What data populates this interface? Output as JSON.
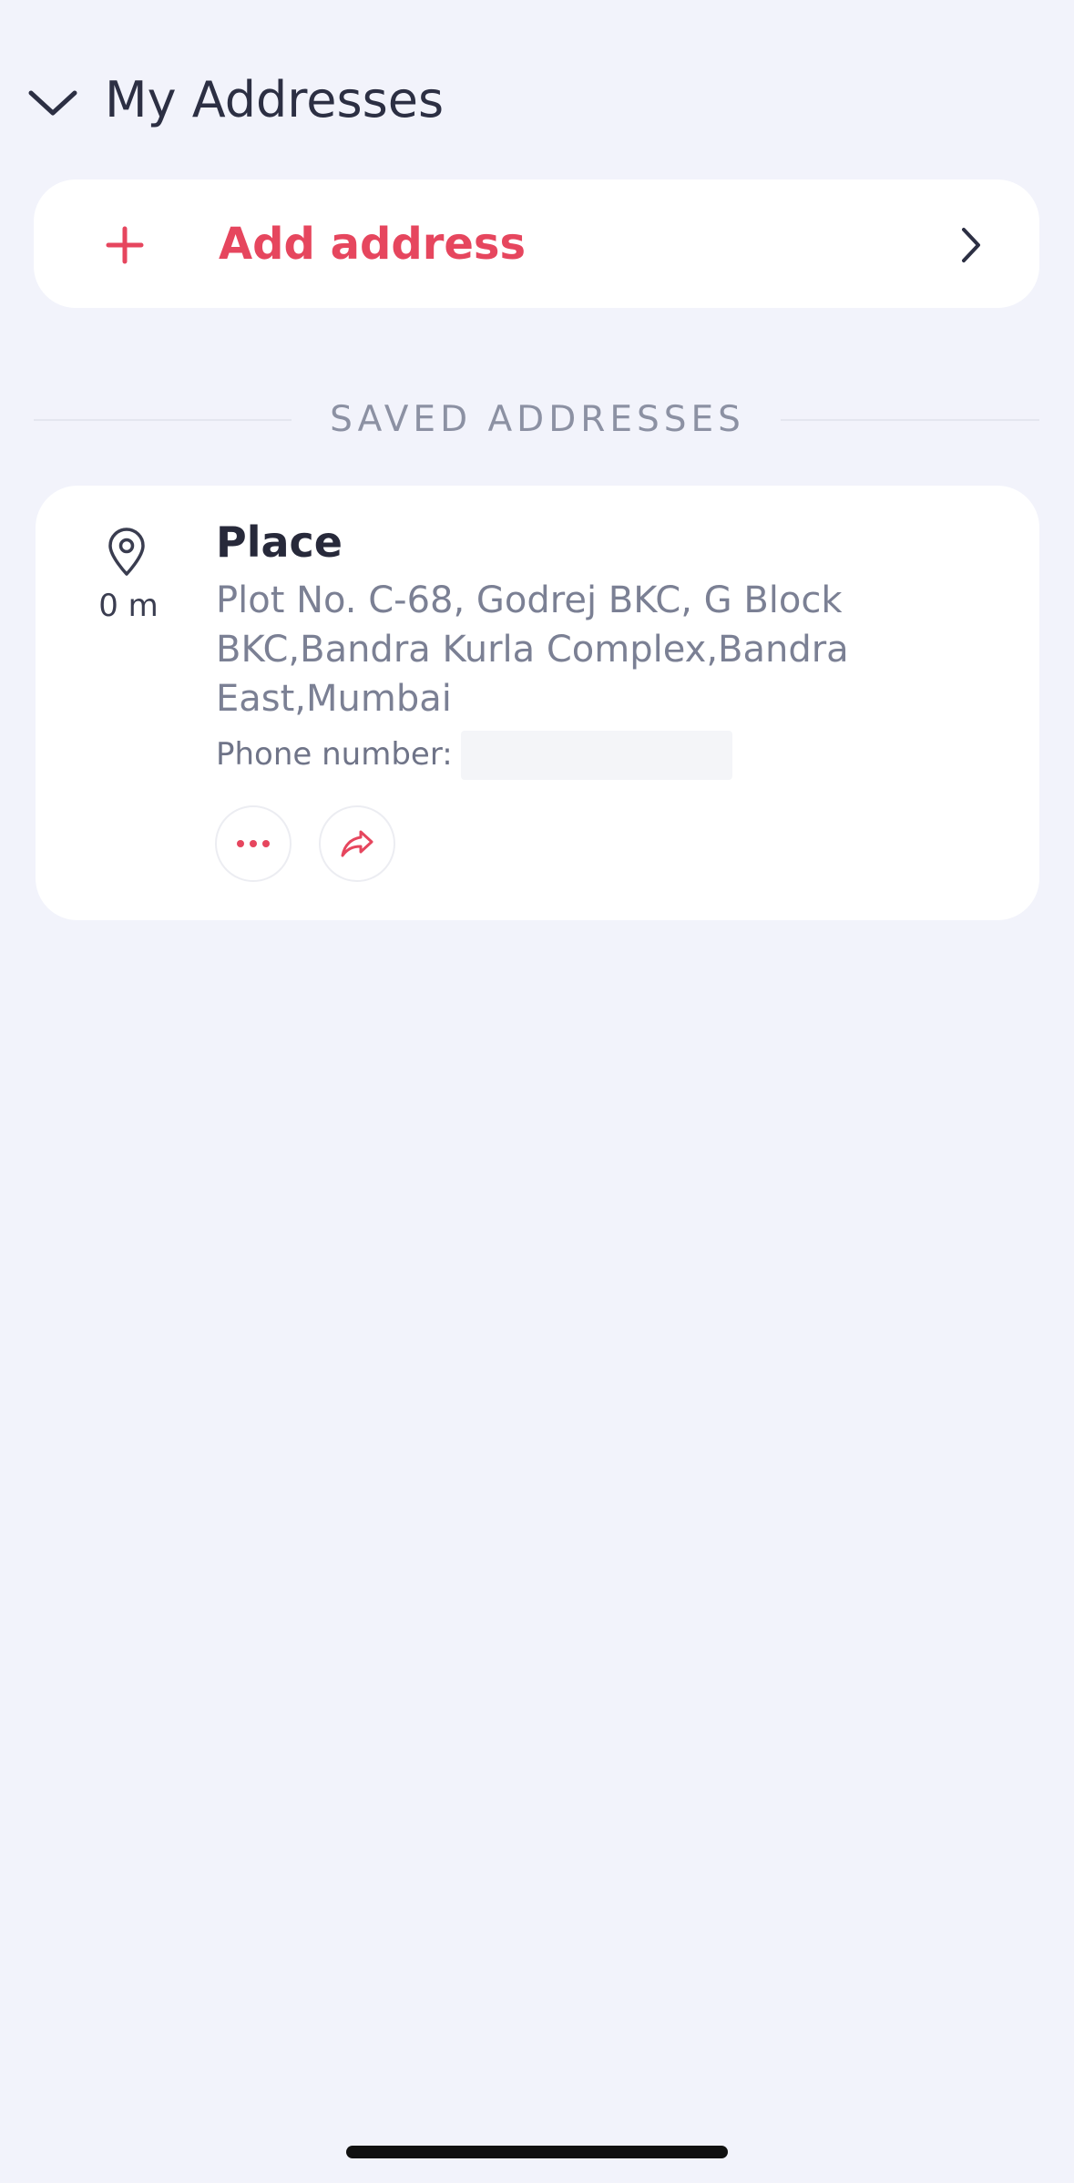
{
  "header": {
    "title": "My Addresses",
    "back_icon": "chevron-down-icon"
  },
  "add_address": {
    "label": "Add address",
    "icon": "plus-icon",
    "trailing_icon": "chevron-right-icon",
    "accent_color": "#E6465E"
  },
  "saved_section": {
    "heading": "SAVED ADDRESSES"
  },
  "addresses": [
    {
      "name": "Place",
      "distance": "0 m",
      "address": "Plot No. C-68, Godrej BKC, G Block BKC,Bandra Kurla Complex,Bandra East,Mumbai",
      "phone_label": "Phone number:",
      "phone_value": "",
      "actions": [
        {
          "name": "more",
          "icon": "more-dots-icon"
        },
        {
          "name": "share",
          "icon": "share-icon"
        }
      ]
    }
  ],
  "colors": {
    "background": "#F2F3FB",
    "card": "#FFFFFF",
    "accent": "#E6465E",
    "muted_text": "#7B8094"
  }
}
